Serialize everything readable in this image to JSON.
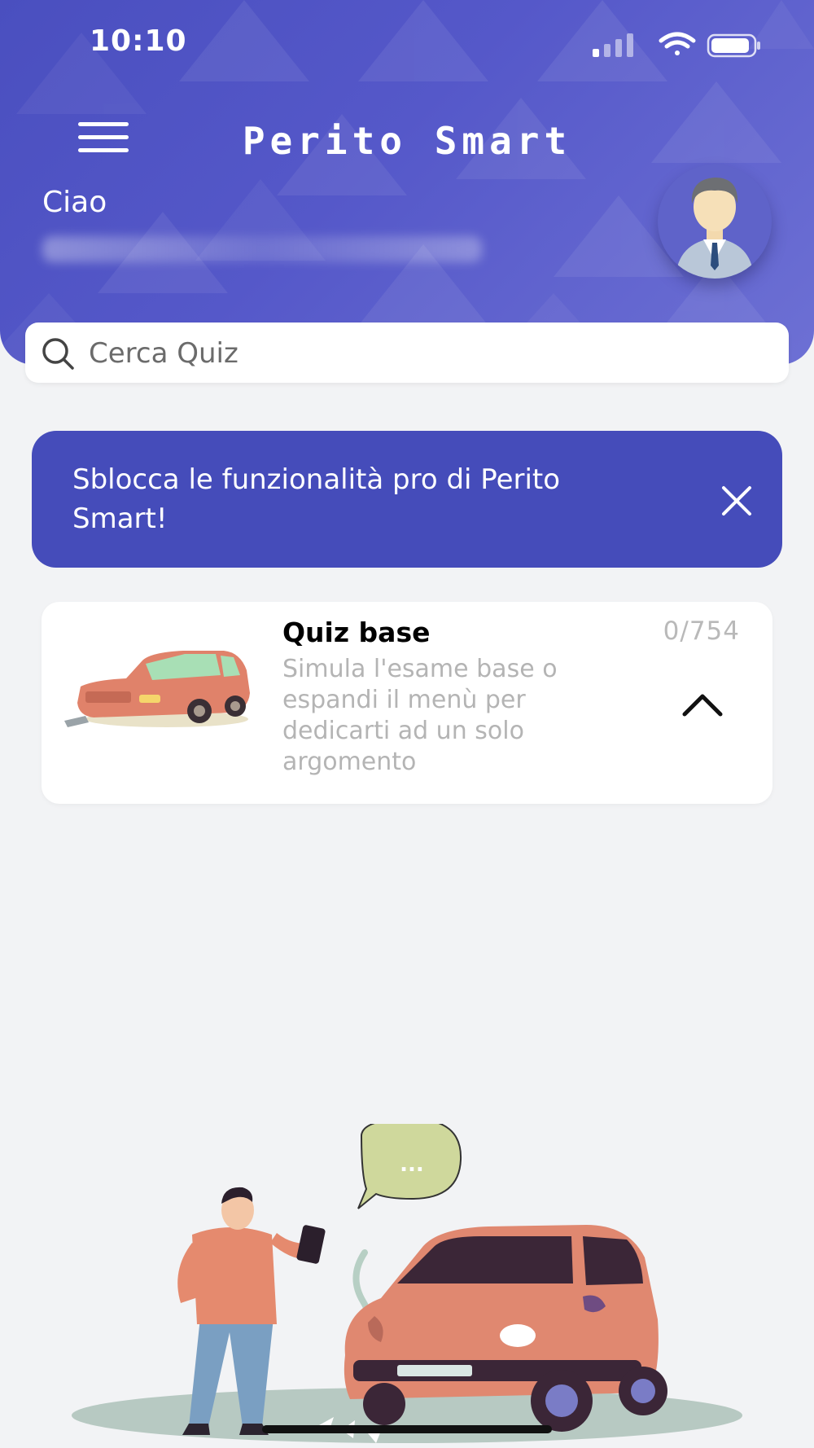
{
  "status_bar": {
    "time": "10:10"
  },
  "header": {
    "title": "Perito Smart",
    "greeting": "Ciao",
    "menu_icon": "hamburger-menu-icon",
    "avatar_icon": "user-avatar-icon"
  },
  "search": {
    "placeholder": "Cerca Quiz"
  },
  "promo_banner": {
    "text": "Sblocca le funzionalità pro di Perito Smart!"
  },
  "quiz_card": {
    "title": "Quiz base",
    "progress": "0/754",
    "description": "Simula l'esame base o espandi il menù per dedicarti ad un solo argomento"
  },
  "illustration": {
    "speech_bubble": "..."
  },
  "colors": {
    "header": "#4a4fbf",
    "banner": "#454cba",
    "background": "#f2f3f5"
  }
}
